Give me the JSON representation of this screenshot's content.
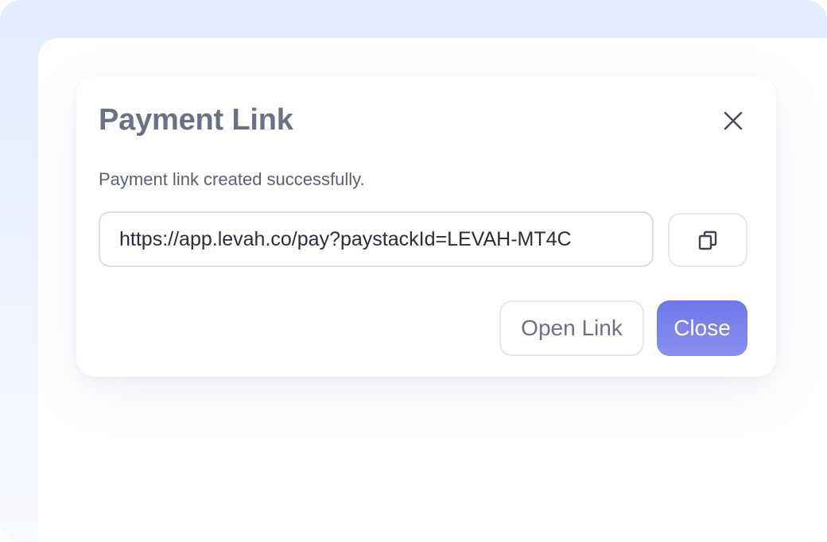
{
  "modal": {
    "title": "Payment Link",
    "message": "Payment link created successfully.",
    "link_value": "https://app.levah.co/pay?paystackId=LEVAH-MT4C",
    "close_icon": "close-icon",
    "copy_icon": "copy-icon"
  },
  "actions": {
    "open_label": "Open Link",
    "close_label": "Close"
  },
  "colors": {
    "accent": "#7880ea",
    "title": "#6b7083",
    "text": "#5b6072",
    "border": "#d9dce3",
    "background": "#e8eefd"
  }
}
